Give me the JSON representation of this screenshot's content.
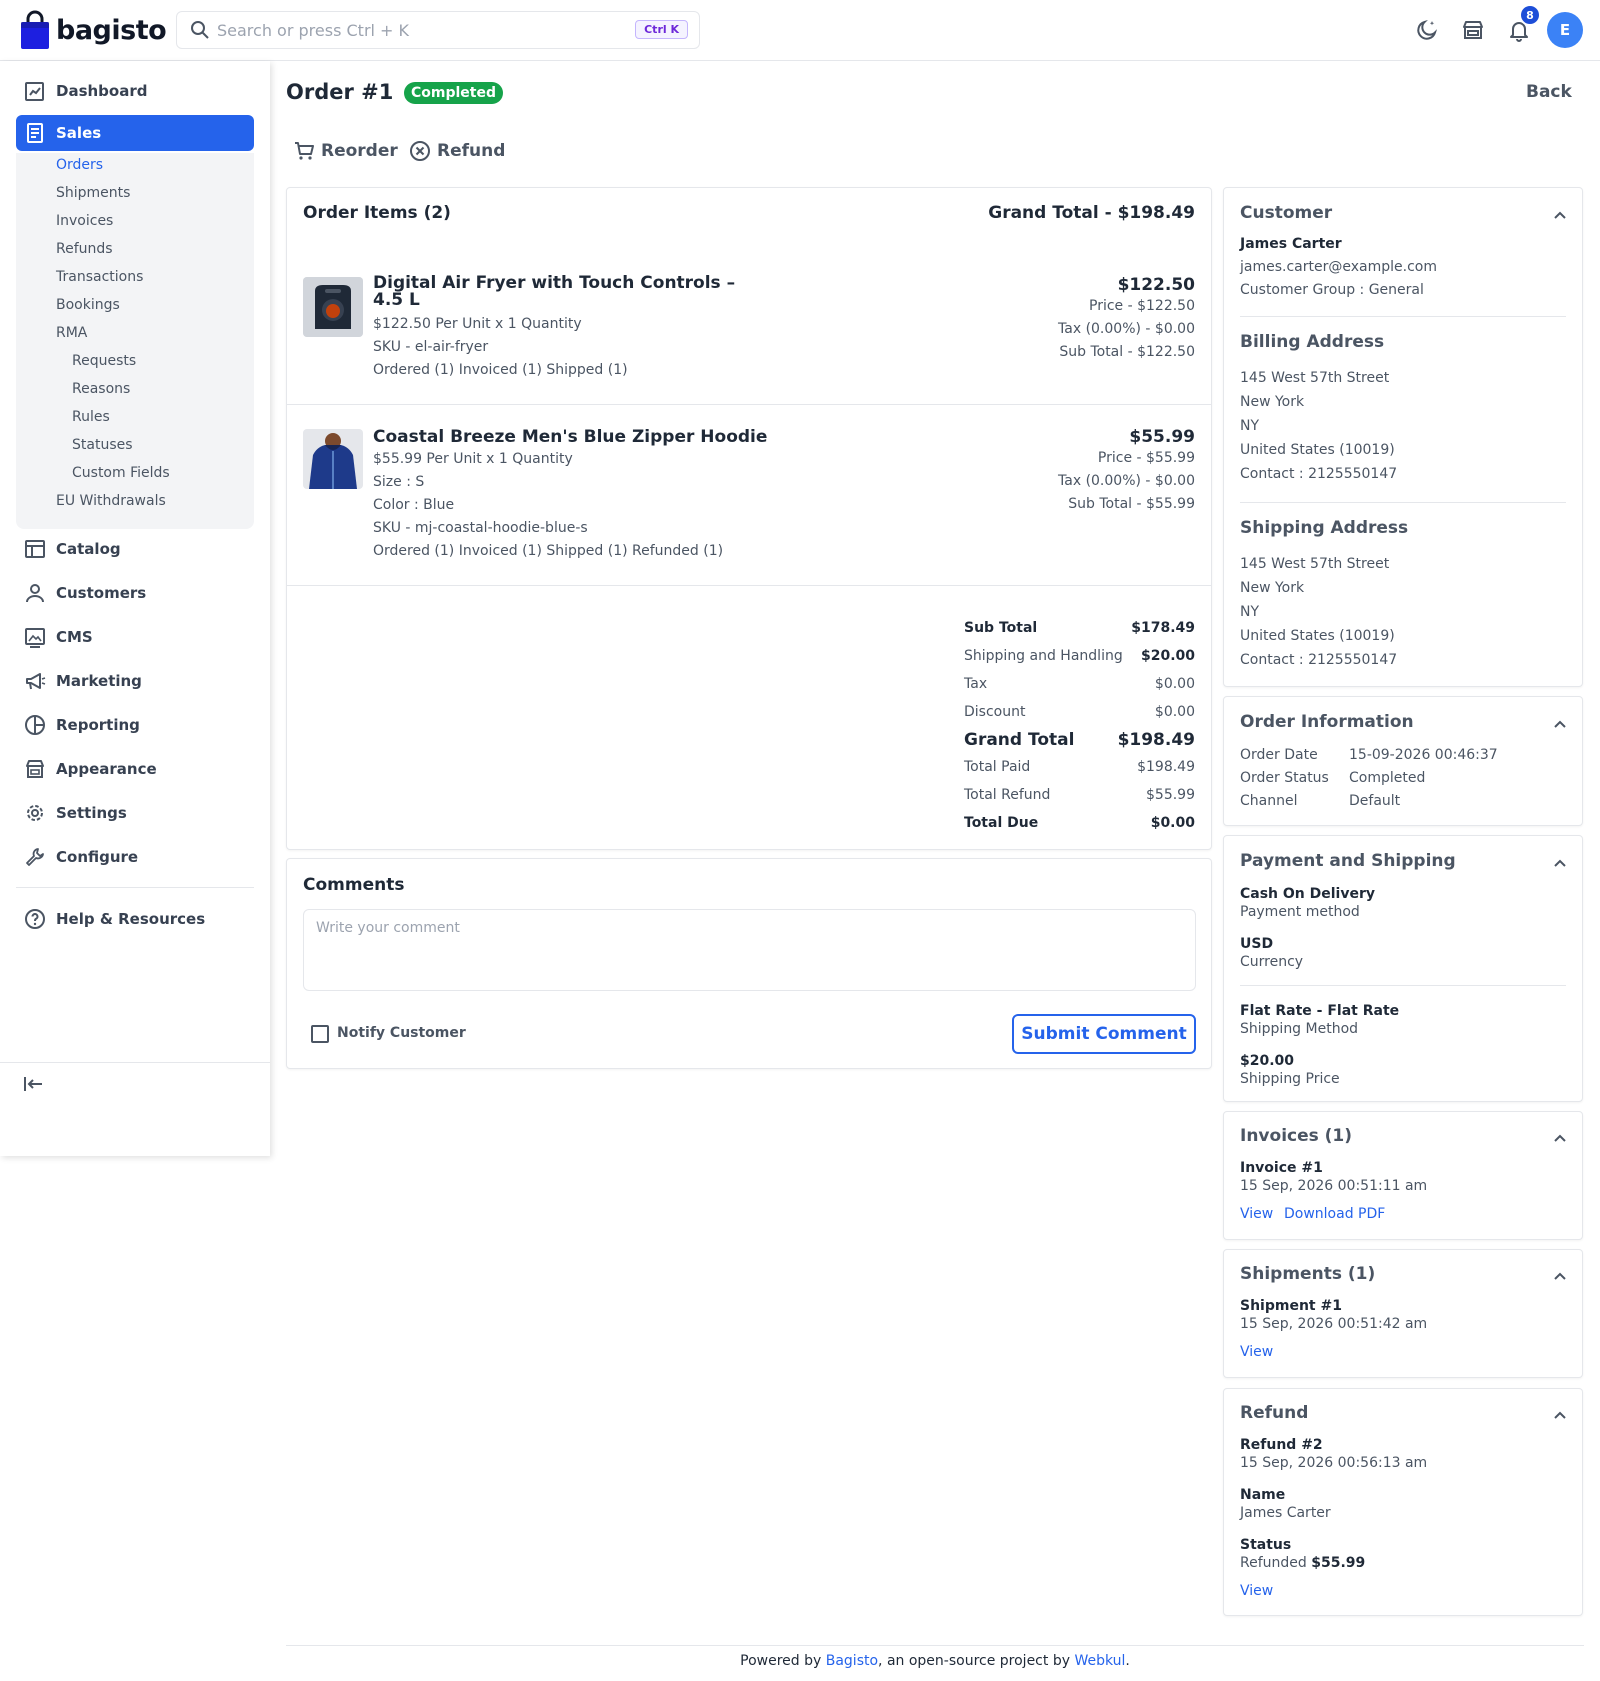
{
  "brand": {
    "name": "bagisto",
    "color": "#2563eb"
  },
  "search": {
    "placeholder": "Search or press Ctrl + K",
    "shortcut": "Ctrl K"
  },
  "header": {
    "notification_count": "8",
    "avatar_initial": "E",
    "icons": [
      "moon-icon",
      "store-icon",
      "bell-icon"
    ]
  },
  "sidebar": {
    "items": [
      {
        "label": "Dashboard",
        "icon": "dashboard-icon"
      },
      {
        "label": "Sales",
        "icon": "sales-icon",
        "active": true
      },
      {
        "label": "Catalog",
        "icon": "catalog-icon"
      },
      {
        "label": "Customers",
        "icon": "customers-icon"
      },
      {
        "label": "CMS",
        "icon": "cms-icon"
      },
      {
        "label": "Marketing",
        "icon": "marketing-icon"
      },
      {
        "label": "Reporting",
        "icon": "reporting-icon"
      },
      {
        "label": "Appearance",
        "icon": "appearance-icon"
      },
      {
        "label": "Settings",
        "icon": "settings-icon"
      },
      {
        "label": "Configure",
        "icon": "configure-icon"
      },
      {
        "label": "Help & Resources",
        "icon": "help-icon"
      }
    ],
    "sales_sub": [
      "Orders",
      "Shipments",
      "Invoices",
      "Refunds",
      "Transactions",
      "Bookings",
      "RMA",
      "Requests",
      "Reasons",
      "Rules",
      "Statuses",
      "Custom Fields",
      "EU Withdrawals"
    ]
  },
  "order": {
    "title": "Order #1",
    "status_badge": "Completed",
    "back": "Back",
    "actions": {
      "reorder": "Reorder",
      "refund": "Refund"
    }
  },
  "items_card": {
    "title": "Order Items (2)",
    "grand_total": "Grand Total - $198.49",
    "items": [
      {
        "name": "Digital Air Fryer with Touch Controls – 4.5 L",
        "lines": [
          "$122.50 Per Unit x 1 Quantity",
          "SKU - el-air-fryer",
          "Ordered (1) Invoiced (1) Shipped (1)"
        ],
        "total": "$122.50",
        "price": "Price - $122.50",
        "tax": "Tax (0.00%) - $0.00",
        "subtotal": "Sub Total - $122.50"
      },
      {
        "name": "Coastal Breeze Men's Blue Zipper Hoodie",
        "lines": [
          "$55.99 Per Unit x 1 Quantity",
          "Size : S",
          "Color : Blue",
          "SKU - mj-coastal-hoodie-blue-s",
          "Ordered (1) Invoiced (1) Shipped (1) Refunded (1)"
        ],
        "total": "$55.99",
        "price": "Price - $55.99",
        "tax": "Tax (0.00%) - $0.00",
        "subtotal": "Sub Total - $55.99"
      }
    ],
    "summary": [
      {
        "label": "Sub Total",
        "value": "$178.49"
      },
      {
        "label": "Shipping and Handling",
        "value": "$20.00"
      },
      {
        "label": "Tax",
        "value": "$0.00"
      },
      {
        "label": "Discount",
        "value": "$0.00"
      },
      {
        "label": "Grand Total",
        "value": "$198.49"
      },
      {
        "label": "Total Paid",
        "value": "$198.49"
      },
      {
        "label": "Total Refund",
        "value": "$55.99"
      },
      {
        "label": "Total Due",
        "value": "$0.00"
      }
    ]
  },
  "comments": {
    "title": "Comments",
    "placeholder": "Write your comment",
    "notify": "Notify Customer",
    "submit": "Submit Comment"
  },
  "customer": {
    "title": "Customer",
    "name": "James Carter",
    "email": "james.carter@example.com",
    "group": "Customer Group : General",
    "billing_title": "Billing Address",
    "billing": [
      "145 West 57th Street",
      "New York",
      "NY",
      "United States (10019)",
      "Contact : 2125550147"
    ],
    "shipping_title": "Shipping Address",
    "shipping": [
      "145 West 57th Street",
      "New York",
      "NY",
      "United States (10019)",
      "Contact : 2125550147"
    ]
  },
  "order_info": {
    "title": "Order Information",
    "rows": [
      {
        "label": "Order Date",
        "value": "15-09-2026 00:46:37"
      },
      {
        "label": "Order Status",
        "value": "Completed"
      },
      {
        "label": "Channel",
        "value": "Default"
      }
    ]
  },
  "payment": {
    "title": "Payment and Shipping",
    "method": "Cash On Delivery",
    "method_label": "Payment method",
    "currency": "USD",
    "currency_label": "Currency",
    "shipping_method": "Flat Rate - Flat Rate",
    "shipping_method_label": "Shipping Method",
    "shipping_price": "$20.00",
    "shipping_price_label": "Shipping Price"
  },
  "invoices": {
    "title": "Invoices (1)",
    "number": "Invoice #1",
    "date": "15 Sep, 2026 00:51:11 am",
    "view": "View",
    "download": "Download PDF"
  },
  "shipments": {
    "title": "Shipments (1)",
    "number": "Shipment #1",
    "date": "15 Sep, 2026 00:51:42 am",
    "view": "View"
  },
  "refund": {
    "title": "Refund",
    "number": "Refund #2",
    "date": "15 Sep, 2026 00:56:13 am",
    "name_label": "Name",
    "name": "James Carter",
    "status_label": "Status",
    "status_prefix": "Refunded",
    "status_amount": "$55.99",
    "view": "View"
  },
  "footer": {
    "prefix": "Powered by",
    "bagisto": "Bagisto",
    "middle": ", an open-source project by",
    "webkul": "Webkul",
    "suffix": "."
  }
}
